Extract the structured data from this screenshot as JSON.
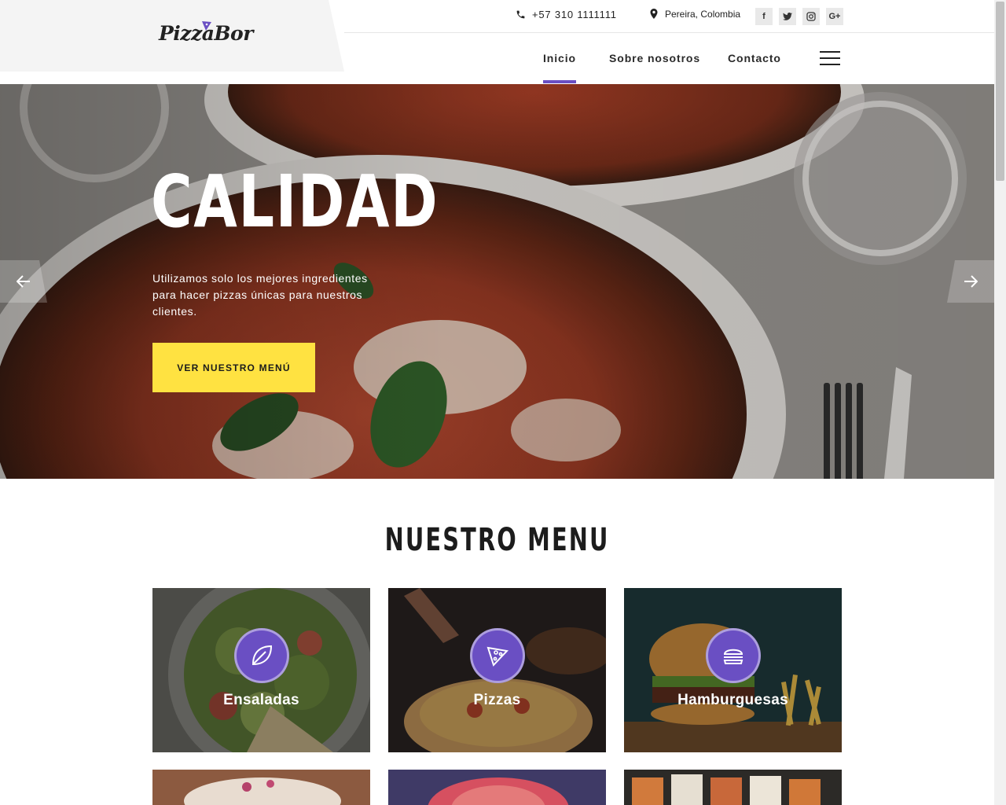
{
  "brand": {
    "name": "PizzaBor"
  },
  "topbar": {
    "phone": "+57 310 1111111",
    "location": "Pereira, Colombia",
    "socials": [
      {
        "label": "f",
        "icon": "facebook-icon"
      },
      {
        "label": "t",
        "icon": "twitter-icon"
      },
      {
        "label": "ig",
        "icon": "instagram-icon"
      },
      {
        "label": "G+",
        "icon": "google-plus-icon"
      }
    ]
  },
  "nav": {
    "items": [
      {
        "label": "Inicio",
        "active": true
      },
      {
        "label": "Sobre nosotros",
        "active": false
      },
      {
        "label": "Contacto",
        "active": false
      }
    ]
  },
  "hero": {
    "title": "CALIDAD",
    "text": "Utilizamos solo los mejores ingredientes para hacer pizzas únicas para nuestros clientes.",
    "button": "VER NUESTRO MENÚ"
  },
  "menu": {
    "title": "NUESTRO MENU",
    "cards": [
      {
        "label": "Ensaladas",
        "icon": "leaf-icon"
      },
      {
        "label": "Pizzas",
        "icon": "pizza-slice-icon"
      },
      {
        "label": "Hamburguesas",
        "icon": "burger-icon"
      }
    ]
  },
  "colors": {
    "accent": "#6a4fc3",
    "button": "#ffe241",
    "text": "#1a1a1a"
  }
}
